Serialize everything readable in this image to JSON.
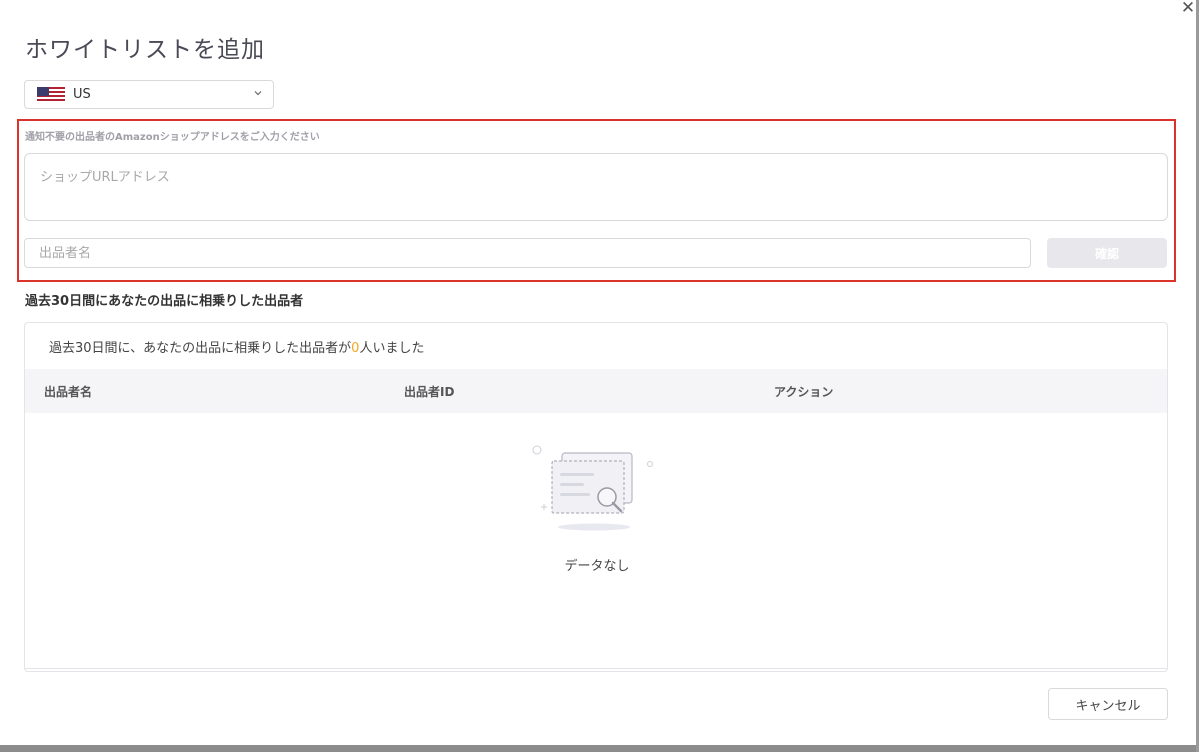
{
  "dialog": {
    "title": "ホワイトリストを追加",
    "close_icon": "close-icon"
  },
  "country": {
    "selected": "US",
    "flag_icon": "us-flag-icon",
    "chevron_icon": "chevron-down-icon"
  },
  "form": {
    "hint": "通知不要の出品者のAmazonショップアドレスをご入力ください",
    "url_placeholder": "ショップURLアドレス",
    "seller_placeholder": "出品者名",
    "confirm_label": "確認",
    "highlight_color": "#d9332b"
  },
  "section": {
    "heading": "過去30日間にあなたの出品に相乗りした出品者",
    "summary_prefix": "過去30日間に、あなたの出品に相乗りした出品者が",
    "summary_count": "0",
    "summary_suffix": "人いました",
    "count_color": "#f5a623",
    "columns": [
      "出品者名",
      "出品者ID",
      "アクション"
    ],
    "empty_text": "データなし"
  },
  "footer": {
    "cancel_label": "キャンセル"
  }
}
